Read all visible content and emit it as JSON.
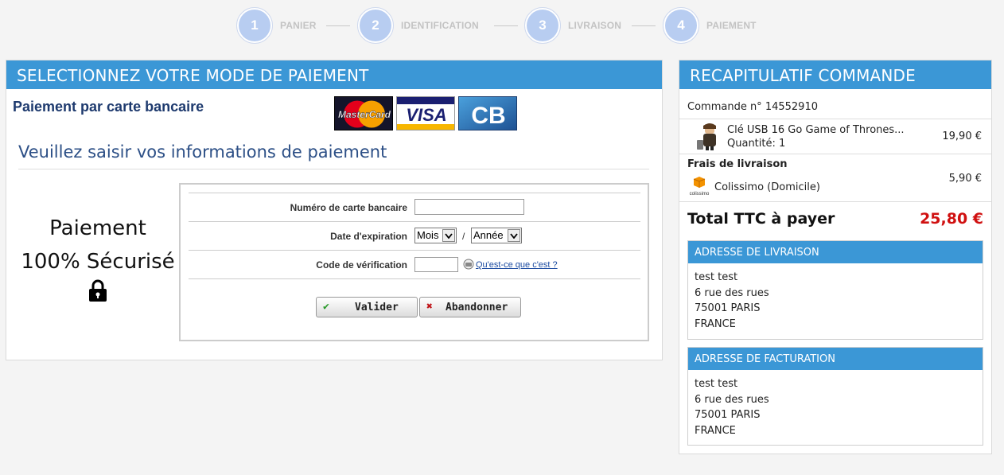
{
  "steps": [
    {
      "num": "1",
      "label": "PANIER"
    },
    {
      "num": "2",
      "label": "IDENTIFICATION"
    },
    {
      "num": "3",
      "label": "LIVRAISON"
    },
    {
      "num": "4",
      "label": "PAIEMENT"
    }
  ],
  "payment": {
    "header": "SELECTIONNEZ VOTRE MODE DE PAIEMENT",
    "method_title": "Paiement par carte bancaire",
    "cards": [
      "MasterCard",
      "VISA",
      "CB"
    ],
    "subtitle": "Veuillez saisir vos informations de paiement",
    "secure_line1": "Paiement",
    "secure_line2": "100% Sécurisé",
    "form": {
      "card_number_label": "Numéro de carte bancaire",
      "card_number_value": "",
      "expiry_label": "Date d'expiration",
      "month_selected": "Mois",
      "separator": "/",
      "year_selected": "Année",
      "cvv_label": "Code de vérification",
      "cvv_value": "",
      "help_link": "Qu'est-ce que c'est ?",
      "validate_label": "Valider",
      "cancel_label": "Abandonner"
    }
  },
  "summary": {
    "header": "RECAPITULATIF COMMANDE",
    "order_label": "Commande n° 14552910",
    "item": {
      "name": "Clé USB 16 Go Game of Thrones...",
      "quantity": "Quantité: 1",
      "price": "19,90 €"
    },
    "shipping_title": "Frais de livraison",
    "shipping_method": "Colissimo (Domicile)",
    "shipping_logo_text": "colissimo",
    "shipping_price": "5,90 €",
    "total_label": "Total TTC à payer",
    "total_value": "25,80 €",
    "delivery_address": {
      "title": "ADRESSE DE LIVRAISON",
      "lines": [
        "test test",
        "6 rue des rues",
        "75001 PARIS",
        "FRANCE"
      ]
    },
    "billing_address": {
      "title": "ADRESSE DE FACTURATION",
      "lines": [
        "test test",
        "6 rue des rues",
        "75001 PARIS",
        "FRANCE"
      ]
    }
  },
  "colors": {
    "accent_blue": "#3b97d6",
    "step_circle": "#b8cdf1",
    "title_navy": "#1e3a6e",
    "total_red": "#d01010"
  }
}
